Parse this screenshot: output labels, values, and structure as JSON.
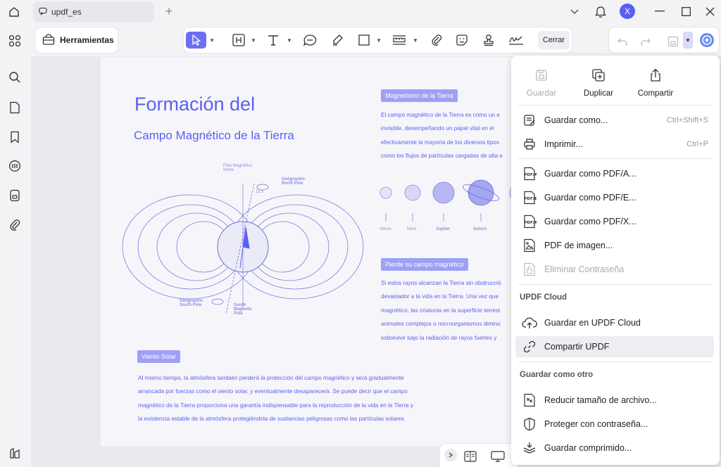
{
  "tab": {
    "title": "updf_es"
  },
  "user": {
    "initial": "X"
  },
  "toolbar": {
    "tools_label": "Herramientas",
    "close_label": "Cerrar"
  },
  "document": {
    "title_line1": "Formación del",
    "title_line2": "Campo Magnético de la Tierra",
    "section1_label": "Magnetismo de la Tierra",
    "section1_lines": [
      "El campo magnético de la Tierra es como un e",
      "invisible, desempeñando un papel vital en el",
      "efectivamente la mayoría de los diversos tipos",
      "como los flujos de partículas cargadas de alta e"
    ],
    "diagram_labels": {
      "polo_norte": "Polo Magnético Norte",
      "geo_north": "Geographic North Pole",
      "angle": "11.5",
      "geo_south": "Geographic South Pole",
      "mag_south": "South Magnetic Pole"
    },
    "planets": [
      "Venus",
      "Mars",
      "Jupiter",
      "Saturn"
    ],
    "section2_label": "Pierde su campo magnético",
    "section2_lines": [
      "Si estos rayos alcanzan la Tierra sin obstrucció",
      "devastador a la vida en la Tierra. Una vez que",
      "magnético, las criaturas en la superficie terrest",
      "animales complejos o microorganismos diminu",
      "sobrevivir bajo la radiación de rayos fuertes y"
    ],
    "section3_label": "Viento Solar",
    "section3_lines": [
      "Al mismo tiempo, la atmósfera también perderá la protección del campo magnético y será gradualmente",
      "arrancada por fuerzas como el viento solar, y eventualmente desaparecerá. Se puede decir que el campo",
      "magnético de la Tierra proporciona una garantía indispensable para la reproducción de la vida en la Tierra y",
      " la existencia estable de la atmósfera protegiéndola de sustancias peligrosas como las partículas solares."
    ]
  },
  "menu": {
    "quick": {
      "save": "Guardar",
      "duplicate": "Duplicar",
      "share": "Compartir"
    },
    "items": [
      {
        "label": "Guardar como...",
        "shortcut": "Ctrl+Shift+S"
      },
      {
        "label": "Imprimir...",
        "shortcut": "Ctrl+P"
      },
      {
        "label": "Guardar como PDF/A..."
      },
      {
        "label": "Guardar como PDF/E..."
      },
      {
        "label": "Guardar como PDF/X..."
      },
      {
        "label": "PDF de imagen..."
      },
      {
        "label": "Eliminar Contraseña"
      }
    ],
    "cloud_header": "UPDF Cloud",
    "cloud_items": [
      {
        "label": "Guardar en UPDF Cloud"
      },
      {
        "label": "Compartir UPDF"
      }
    ],
    "other_header": "Guardar como otro",
    "other_items": [
      {
        "label": "Reducir tamaño de archivo..."
      },
      {
        "label": "Proteger con contraseña..."
      },
      {
        "label": "Guardar comprimido..."
      }
    ]
  }
}
